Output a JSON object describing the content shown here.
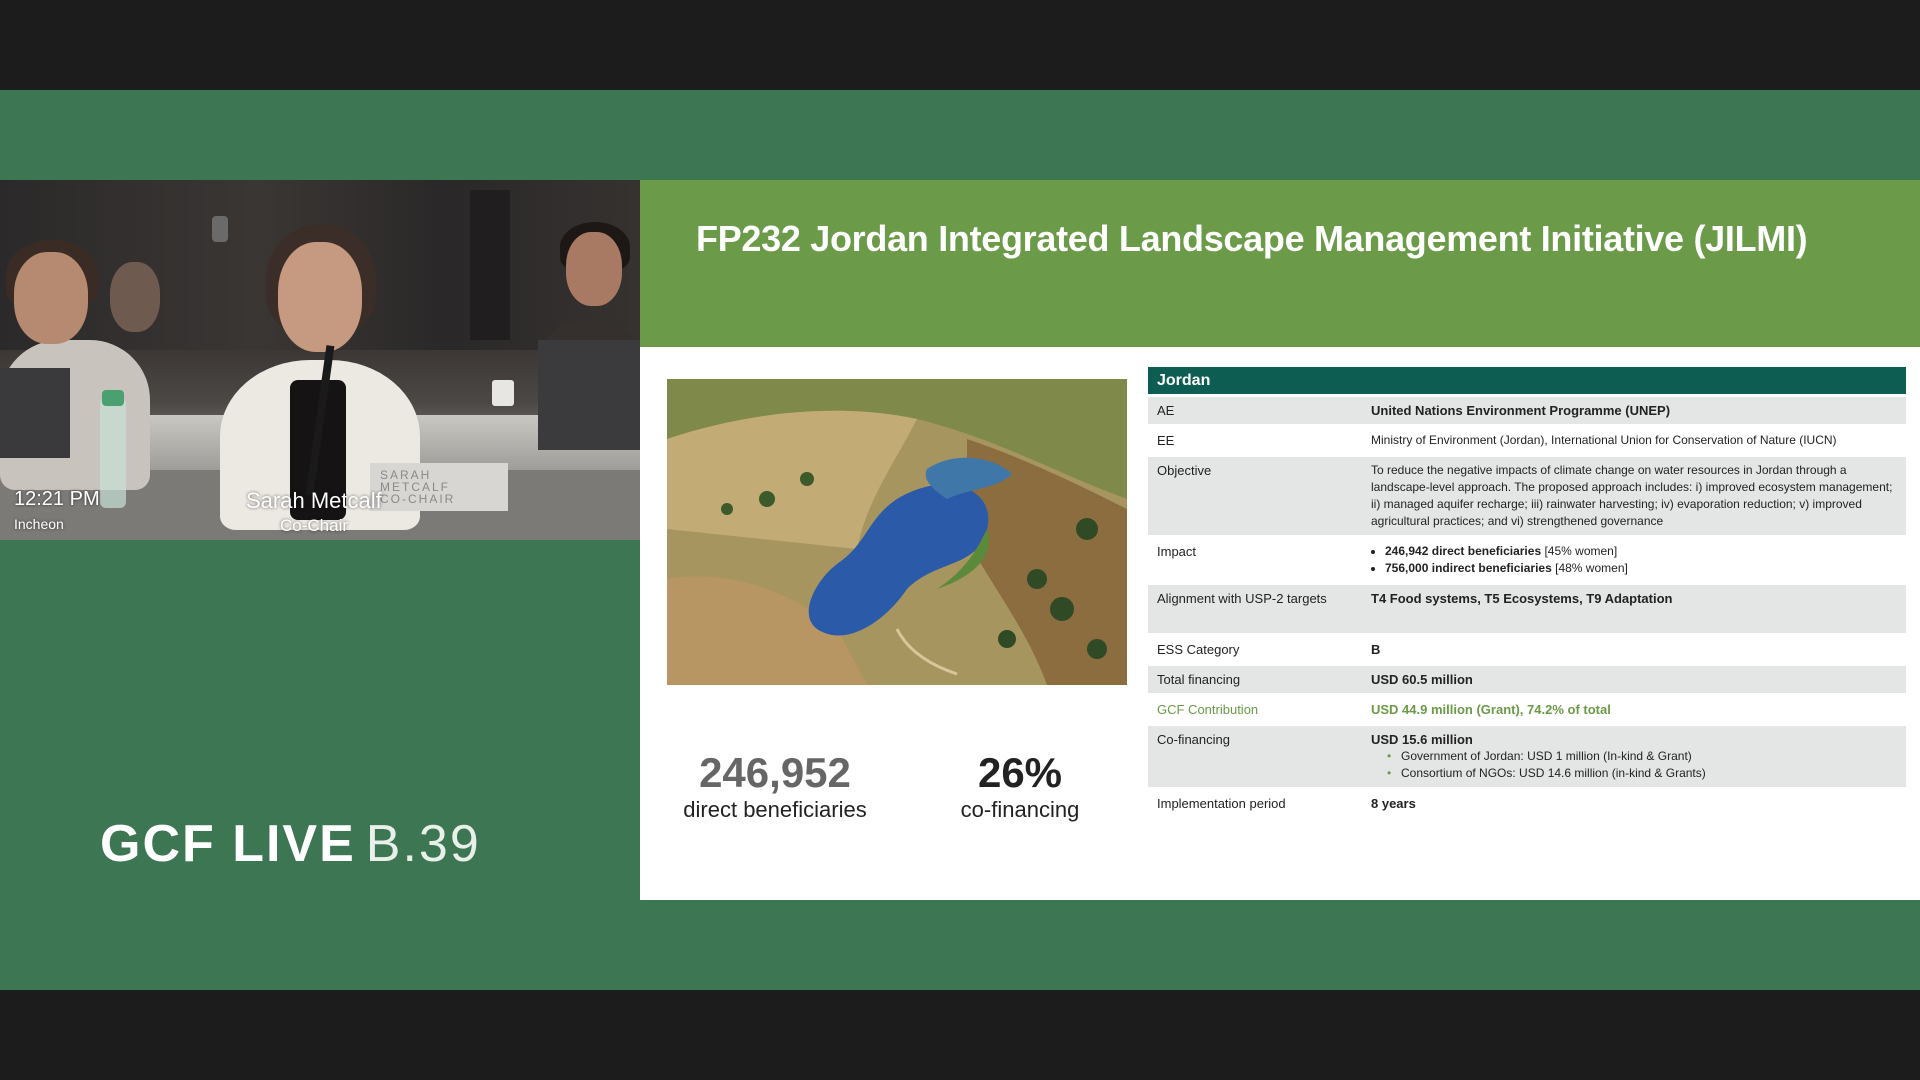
{
  "video": {
    "time": "12:21 PM",
    "location": "Incheon",
    "speaker_name": "Sarah Metcalf",
    "speaker_role": "Co-Chair",
    "nameplate_lines": [
      "SARAH",
      "METCALF",
      "CO-CHAIR"
    ]
  },
  "brand": {
    "main": "GCF LIVE",
    "sub": "B.39"
  },
  "slide": {
    "title": "FP232 Jordan Integrated Landscape Management Initiative (JILMI)",
    "stats": [
      {
        "value": "246,952",
        "label": "direct beneficiaries"
      },
      {
        "value": "26%",
        "label": "co-financing"
      }
    ],
    "table": {
      "header": "Jordan",
      "rows": {
        "ae": {
          "label": "AE",
          "value": "United Nations Environment Programme (UNEP)"
        },
        "ee": {
          "label": "EE",
          "value": "Ministry of Environment (Jordan), International Union for Conservation of Nature (IUCN)"
        },
        "objective": {
          "label": "Objective",
          "value": "To reduce the negative impacts of climate change on water resources in Jordan through a landscape-level approach. The proposed approach includes: i) improved ecosystem management; ii) managed aquifer recharge; iii) rainwater harvesting; iv) evaporation reduction; v) improved agricultural practices; and vi) strengthened governance"
        },
        "impact": {
          "label": "Impact",
          "items": [
            {
              "number": "246,942",
              "text": "direct beneficiaries",
              "note": "[45% women]"
            },
            {
              "number": "756,000",
              "text": "indirect beneficiaries",
              "note": "[48% women]"
            }
          ]
        },
        "alignment": {
          "label": "Alignment with USP-2 targets",
          "value": "T4 Food systems, T5 Ecosystems, T9 Adaptation"
        },
        "ess": {
          "label": "ESS Category",
          "value": "B"
        },
        "total": {
          "label": "Total financing",
          "value": "USD 60.5 million"
        },
        "gcf": {
          "label": "GCF Contribution",
          "value": "USD 44.9 million (Grant), 74.2% of total"
        },
        "cofin": {
          "label": "Co-financing",
          "value": "USD 15.6 million",
          "items": [
            "Government of Jordan: USD 1 million (In-kind & Grant)",
            "Consortium of NGOs: USD 14.6 million (in-kind & Grants)"
          ]
        },
        "period": {
          "label": "Implementation period",
          "value": "8 years"
        }
      }
    }
  },
  "colors": {
    "stage_green": "#3d7653",
    "header_green": "#6b9a48",
    "table_header_teal": "#0e5d52",
    "letterbox": "#1c1c1c"
  }
}
